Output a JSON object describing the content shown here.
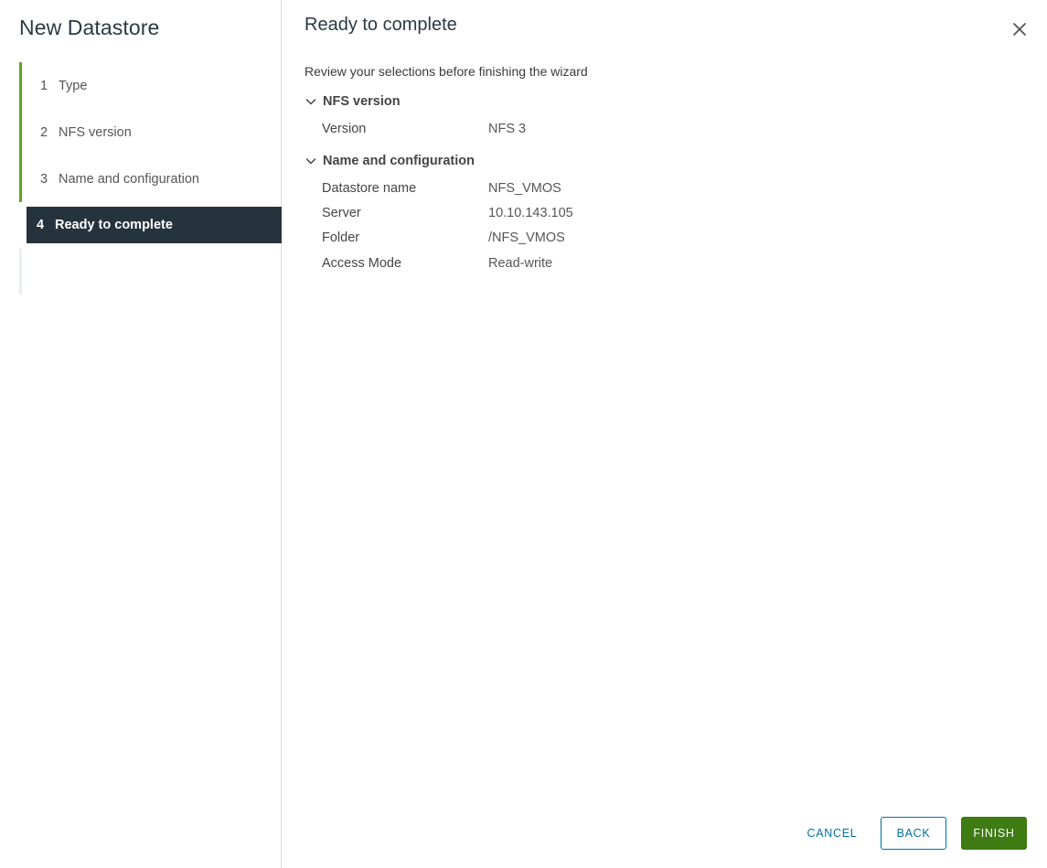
{
  "wizard": {
    "title": "New Datastore",
    "steps": [
      {
        "num": "1",
        "label": "Type"
      },
      {
        "num": "2",
        "label": "NFS version"
      },
      {
        "num": "3",
        "label": "Name and configuration"
      },
      {
        "num": "4",
        "label": "Ready to complete"
      }
    ]
  },
  "main": {
    "title": "Ready to complete",
    "intro": "Review your selections before finishing the wizard",
    "sections": [
      {
        "header": "NFS version",
        "rows": [
          {
            "key": "Version",
            "value": "NFS 3"
          }
        ]
      },
      {
        "header": "Name and configuration",
        "rows": [
          {
            "key": "Datastore name",
            "value": "NFS_VMOS"
          },
          {
            "key": "Server",
            "value": "10.10.143.105"
          },
          {
            "key": "Folder",
            "value": "/NFS_VMOS"
          },
          {
            "key": "Access Mode",
            "value": "Read-write"
          }
        ]
      }
    ]
  },
  "footer": {
    "cancel_label": "CANCEL",
    "back_label": "BACK",
    "finish_label": "FINISH"
  },
  "icons": {
    "close": "close-icon",
    "chevron": "chevron-down-icon"
  },
  "colors": {
    "active_step_bg": "#25333d",
    "step_progress": "#62a420",
    "primary_button": "#3e7b13",
    "link": "#0072a3"
  }
}
